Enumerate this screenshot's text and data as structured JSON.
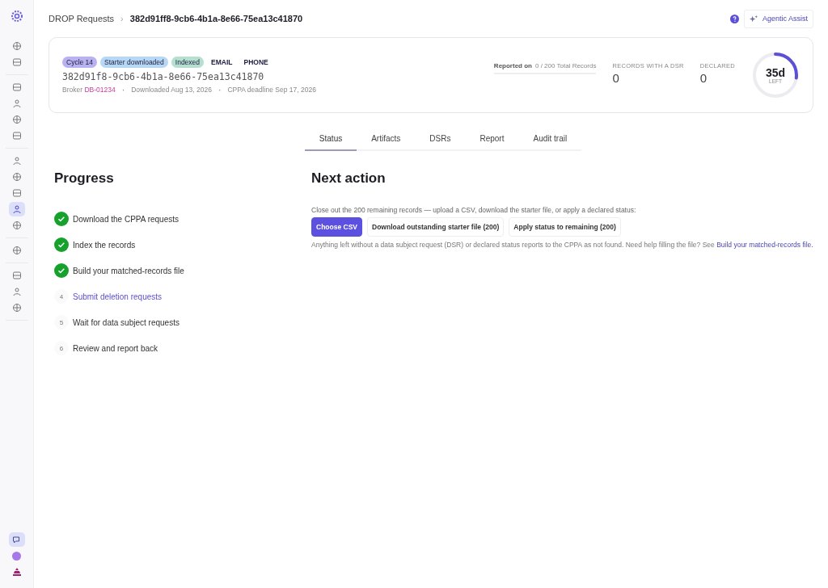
{
  "sidebar": {
    "groups": [
      [
        {
          "selected": false
        },
        {
          "selected": false
        }
      ],
      [
        {
          "selected": false
        },
        {
          "selected": false
        },
        {
          "selected": false
        },
        {
          "selected": false
        }
      ],
      [
        {
          "selected": false
        },
        {
          "selected": false
        },
        {
          "selected": false
        },
        {
          "selected": true
        },
        {
          "selected": false
        }
      ],
      [
        {
          "selected": false
        }
      ],
      [
        {
          "selected": false
        },
        {
          "selected": false
        },
        {
          "selected": false
        }
      ]
    ],
    "bottom": {
      "selected": true
    }
  },
  "breadcrumb": {
    "parent": "DROP Requests",
    "separator": "›",
    "current": "382d91ff8-9cb6-4b1a-8e66-75ea13c41870"
  },
  "header_actions": {
    "assist": "Agentic Assist"
  },
  "summary": {
    "tags": [
      {
        "label": "Cycle 14",
        "kind": "pill",
        "color": "#b9b2f0"
      },
      {
        "label": "Starter downloaded",
        "kind": "pill",
        "color": "#b6d8f5"
      },
      {
        "label": "Indexed",
        "kind": "pill",
        "color": "#b5e0cf"
      },
      {
        "label": "EMAIL",
        "kind": "plain"
      },
      {
        "label": "PHONE",
        "kind": "plain"
      }
    ],
    "id": "382d91f8-9cb6-4b1a-8e66-75ea13c41870",
    "meta": [
      {
        "label": "Broker",
        "link": "DB-01234"
      },
      {
        "separator": "·",
        "label": "Downloaded Aug 13, 2026"
      },
      {
        "separator": "·",
        "label": "CPPA deadline Sep 17, 2026"
      }
    ],
    "reported": {
      "label": "Reported on",
      "value": "0 / 200 Total Records",
      "level": 0
    },
    "stats": [
      {
        "label": "RECORDS WITH A DSR",
        "value": "0"
      },
      {
        "label": "DECLARED",
        "value": "0"
      }
    ],
    "countdown": {
      "value": "35d",
      "caption": "LEFT",
      "level": 0.27
    }
  },
  "tabs": [
    {
      "label": "Status",
      "selected": true
    },
    {
      "label": "Artifacts",
      "selected": false
    },
    {
      "label": "DSRs",
      "selected": false
    },
    {
      "label": "Report",
      "selected": false
    },
    {
      "label": "Audit trail",
      "selected": false
    }
  ],
  "progress": {
    "title": "Progress",
    "steps": [
      {
        "label": "Download the CPPA requests",
        "completed": true,
        "current": false
      },
      {
        "label": "Index the records",
        "completed": true,
        "current": false
      },
      {
        "label": "Build your matched-records file",
        "completed": true,
        "current": false
      },
      {
        "label": "Submit deletion requests",
        "completed": false,
        "current": true,
        "number": "4"
      },
      {
        "label": "Wait for data subject requests",
        "completed": false,
        "current": false,
        "number": "5"
      },
      {
        "label": "Review and report back",
        "completed": false,
        "current": false,
        "number": "6"
      }
    ]
  },
  "next_action": {
    "title": "Next action",
    "intro": "Close out the 200 remaining records — upload a CSV, download the starter file, or apply a declared status:",
    "buttons": [
      {
        "label": "Choose CSV",
        "kind": "primary"
      },
      {
        "label": "Download outstanding starter file (200)",
        "kind": "secondary"
      },
      {
        "label": "Apply status to remaining (200)",
        "kind": "secondary"
      }
    ],
    "note": "Anything left without a data subject request (DSR) or declared status reports to the CPPA as not found. Need help filling the file? See",
    "note_link": "Build your matched-records file."
  }
}
